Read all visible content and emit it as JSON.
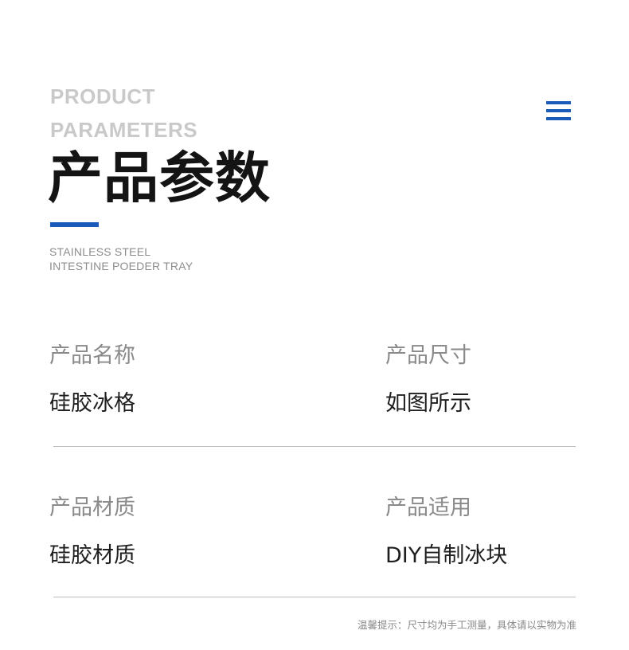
{
  "header": {
    "en_title_line1": "PRODUCT",
    "en_title_line2": "PARAMETERS",
    "cn_title": "产品参数",
    "subtitle_line1": "STAINLESS STEEL",
    "subtitle_line2": "INTESTINE POEDER TRAY",
    "menu_icon": "menu-icon"
  },
  "params": [
    {
      "label": "产品名称",
      "value": "硅胶冰格"
    },
    {
      "label": "产品尺寸",
      "value": "如图所示"
    },
    {
      "label": "产品材质",
      "value": "硅胶材质"
    },
    {
      "label": "产品适用",
      "value": "DIY自制冰块"
    }
  ],
  "footer": {
    "note": "温馨提示：尺寸均为手工测量，具体请以实物为准"
  },
  "colors": {
    "accent": "#1a5ab8",
    "title_text": "#141414",
    "muted_text": "#8a8a8a",
    "en_title": "#c9c9c9",
    "divider": "#bdbdbd"
  }
}
